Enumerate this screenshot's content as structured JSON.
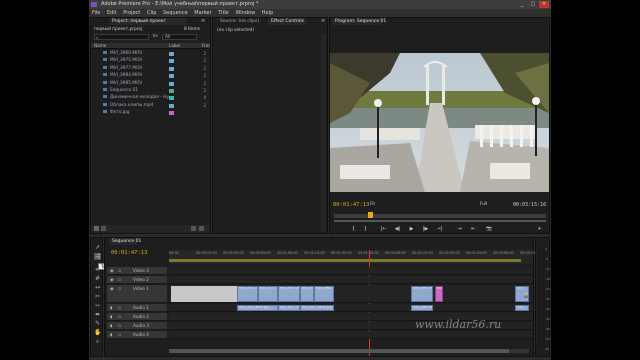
{
  "window": {
    "title": "Adobe Premiere Pro - E:\\Мой учебный\\первый проект.prproj *",
    "controls": [
      "_",
      "□",
      "×"
    ]
  },
  "menu": [
    "File",
    "Edit",
    "Project",
    "Clip",
    "Sequence",
    "Marker",
    "Title",
    "Window",
    "Help"
  ],
  "project_panel": {
    "tab": "Project: первый проект",
    "tab_menu": "≡",
    "file_name": "первый проект.prproj",
    "items_count": "8 Items",
    "in_label": "In:",
    "in_value": "All",
    "search_placeholder": "",
    "columns": {
      "name": "Name",
      "label": "Label",
      "fps": "Frar"
    },
    "items": [
      {
        "name": "MVI_3960.MOV",
        "color": "#6aa8d4",
        "n": "2"
      },
      {
        "name": "MVI_3975.MOV",
        "color": "#6aa8d4",
        "n": "2"
      },
      {
        "name": "MVI_3977.MOV",
        "color": "#6aa8d4",
        "n": "2"
      },
      {
        "name": "MVI_3994.MOV",
        "color": "#6aa8d4",
        "n": "2"
      },
      {
        "name": "MVI_3995.MOV",
        "color": "#6aa8d4",
        "n": "2"
      },
      {
        "name": "Sequence 01",
        "color": "#4fae7a",
        "n": "2"
      },
      {
        "name": "Динамичная молодая - Ну",
        "color": "#3cb8a8",
        "n": "4"
      },
      {
        "name": "Облака клипы.mp4",
        "color": "#6aa8d4",
        "n": "2"
      },
      {
        "name": "Фото.jpg",
        "color": "#c46bc9",
        "n": ""
      }
    ]
  },
  "source_panel": {
    "tabs": [
      "Source: (no clips)",
      "Effect Controls",
      "≡"
    ],
    "body": "(no clip selected)"
  },
  "program_monitor": {
    "tab": "Program: Sequence 01",
    "timecode_current": "00:01:47:13",
    "fit": "Fit",
    "zoom": "Full",
    "timecode_duration": "00:03:15:16",
    "buttons": [
      "{",
      "}",
      "|←",
      "◀|",
      "▶",
      "|▶",
      "→|",
      "⇥",
      "⇤",
      "📷",
      "+"
    ]
  },
  "timeline": {
    "tab": "Sequence 01",
    "timecode": "00:01:47:13",
    "ruler": [
      "00:00",
      "00:00:15:00",
      "00:00:30:00",
      "00:00:45:00",
      "00:01:00:00",
      "00:01:15:00",
      "00:01:30:00",
      "00:01:45:00",
      "00:02:00:00",
      "00:02:15:00",
      "00:02:30:00",
      "00:02:45:00",
      "00:03:00:00",
      "00:03:15:00"
    ],
    "tracks": [
      {
        "id": "v3",
        "label": "Video 3"
      },
      {
        "id": "v2",
        "label": "Video 2"
      },
      {
        "id": "v1",
        "label": "Video 1"
      },
      {
        "id": "a1",
        "label": "Audio 1"
      },
      {
        "id": "a2",
        "label": "Audio 2"
      },
      {
        "id": "a3",
        "label": "Audio 3"
      },
      {
        "id": "a4",
        "label": "Audio 4"
      }
    ],
    "video_clips": [
      "MVI_3975.MOV [V]",
      "MVI_3977.MOV [V]",
      "MVI_3977.MOV [V]",
      "MVI_3994.MOV",
      "MVI_3960.M",
      "MVI_3997.MOV",
      "Фото",
      "MVI_"
    ],
    "audio_clips": [
      "MVI_3975.MOV [A]",
      "MVI_3977.MOV [A]",
      "MVI_3977.MOV [A]",
      "MVI_3994.MOV [A]",
      "MVI_3997.MOV",
      "MVI_"
    ]
  },
  "tooltip": "Track Select Tool (A)",
  "watermark": "www.ildar56.ru",
  "audio_meter": [
    "0",
    "-6",
    "-12",
    "-18",
    "-24",
    "-30",
    "-36",
    "-42",
    "-48",
    "-54",
    "dB"
  ]
}
